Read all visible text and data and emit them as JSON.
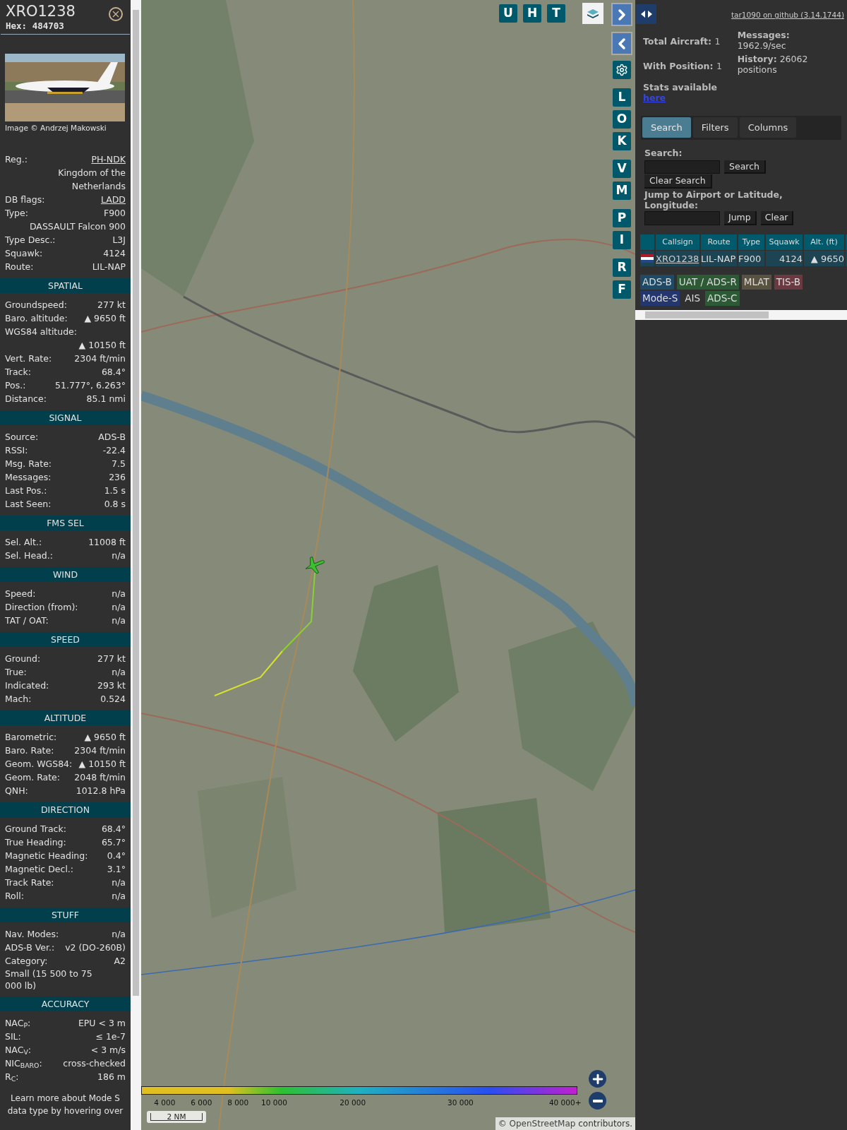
{
  "aircraft": {
    "callsign": "XRO1238",
    "hex": "Hex: 484703",
    "credit": "Image © Andrzej Makowski"
  },
  "sections": [
    {
      "rows": [
        {
          "kind": "pair",
          "label": "Reg.:",
          "value": "PH-NDK",
          "link": true
        },
        {
          "kind": "value",
          "value": "Kingdom of the Netherlands"
        },
        {
          "kind": "pair",
          "label": "DB flags:",
          "value": "LADD",
          "link": true
        },
        {
          "kind": "pair",
          "label": "Type:",
          "value": "F900"
        },
        {
          "kind": "value",
          "value": "DASSAULT Falcon 900"
        },
        {
          "kind": "pair",
          "label": "Type Desc.:",
          "value": "L3J"
        },
        {
          "kind": "pair",
          "label": "Squawk:",
          "value": "4124"
        },
        {
          "kind": "pair",
          "label": "Route:",
          "value": "LIL-NAP"
        }
      ]
    },
    {
      "title": "SPATIAL",
      "rows": [
        {
          "kind": "pair",
          "label": "Groundspeed:",
          "value": "277 kt"
        },
        {
          "kind": "pair",
          "label": "Baro. altitude:",
          "value": "▲ 9650 ft"
        },
        {
          "kind": "label",
          "label": "WGS84 altitude:"
        },
        {
          "kind": "value",
          "value": "▲ 10150 ft"
        },
        {
          "kind": "pair",
          "label": "Vert. Rate:",
          "value": "2304 ft/min"
        },
        {
          "kind": "pair",
          "label": "Track:",
          "value": "68.4°"
        },
        {
          "kind": "pair",
          "label": "Pos.:",
          "value": "51.777°, 6.263°"
        },
        {
          "kind": "pair",
          "label": "Distance:",
          "value": "85.1 nmi"
        }
      ]
    },
    {
      "title": "SIGNAL",
      "rows": [
        {
          "kind": "pair",
          "label": "Source:",
          "value": "ADS-B"
        },
        {
          "kind": "pair",
          "label": "RSSI:",
          "value": "-22.4"
        },
        {
          "kind": "pair",
          "label": "Msg. Rate:",
          "value": "7.5"
        },
        {
          "kind": "pair",
          "label": "Messages:",
          "value": "236"
        },
        {
          "kind": "pair",
          "label": "Last Pos.:",
          "value": "1.5 s"
        },
        {
          "kind": "pair",
          "label": "Last Seen:",
          "value": "0.8 s"
        }
      ]
    },
    {
      "title": "FMS SEL",
      "rows": [
        {
          "kind": "pair",
          "label": "Sel. Alt.:",
          "value": "11008 ft"
        },
        {
          "kind": "pair",
          "label": "Sel. Head.:",
          "value": "n/a"
        }
      ]
    },
    {
      "title": "WIND",
      "rows": [
        {
          "kind": "pair",
          "label": "Speed:",
          "value": "n/a"
        },
        {
          "kind": "pair",
          "label": "Direction (from):",
          "value": "n/a"
        },
        {
          "kind": "pair",
          "label": "TAT / OAT:",
          "value": "n/a"
        }
      ]
    },
    {
      "title": "SPEED",
      "rows": [
        {
          "kind": "pair",
          "label": "Ground:",
          "value": "277 kt"
        },
        {
          "kind": "pair",
          "label": "True:",
          "value": "n/a"
        },
        {
          "kind": "pair",
          "label": "Indicated:",
          "value": "293 kt"
        },
        {
          "kind": "pair",
          "label": "Mach:",
          "value": "0.524"
        }
      ]
    },
    {
      "title": "ALTITUDE",
      "rows": [
        {
          "kind": "pair",
          "label": "Barometric:",
          "value": "▲ 9650 ft"
        },
        {
          "kind": "pair",
          "label": "Baro. Rate:",
          "value": "2304 ft/min"
        },
        {
          "kind": "pair",
          "label": "Geom. WGS84:",
          "value": "▲ 10150 ft"
        },
        {
          "kind": "pair",
          "label": "Geom. Rate:",
          "value": "2048 ft/min"
        },
        {
          "kind": "pair",
          "label": "QNH:",
          "value": "1012.8 hPa"
        }
      ]
    },
    {
      "title": "DIRECTION",
      "rows": [
        {
          "kind": "pair",
          "label": "Ground Track:",
          "value": "68.4°"
        },
        {
          "kind": "pair",
          "label": "True Heading:",
          "value": "65.7°"
        },
        {
          "kind": "pair",
          "label": "Magnetic Heading:",
          "value": "0.4°"
        },
        {
          "kind": "pair",
          "label": "Magnetic Decl.:",
          "value": "3.1°"
        },
        {
          "kind": "pair",
          "label": "Track Rate:",
          "value": "n/a"
        },
        {
          "kind": "pair",
          "label": "Roll:",
          "value": "n/a"
        }
      ]
    },
    {
      "title": "STUFF",
      "rows": [
        {
          "kind": "pair",
          "label": "Nav. Modes:",
          "value": "n/a"
        },
        {
          "kind": "pair",
          "label": "ADS-B Ver.:",
          "value": "v2 (DO-260B)"
        },
        {
          "kind": "pair",
          "label": "Category:",
          "value": "A2"
        },
        {
          "kind": "text",
          "label": "Small (15 500 to 75 000 lb)"
        }
      ]
    },
    {
      "title": "ACCURACY",
      "rows": [
        {
          "kind": "pair",
          "label": "NAC$_{P}$:",
          "value": "EPU < 3 m"
        },
        {
          "kind": "pair",
          "label": "SIL:",
          "value": "≤ 1e-7"
        },
        {
          "kind": "pair",
          "label": "NAC$_{V}$:",
          "value": "< 3 m/s"
        },
        {
          "kind": "pair",
          "label": "NIC$_{BARO}$:",
          "value": "cross-checked"
        },
        {
          "kind": "pair",
          "label": "R$_{C}$:",
          "value": "186 m"
        }
      ]
    }
  ],
  "note": "Learn more about Mode S data type by hovering over",
  "map": {
    "top_buttons": [
      "U",
      "H",
      "T"
    ],
    "side_buttons": [
      [
        "L",
        "O",
        "K"
      ],
      [
        "V",
        "M"
      ],
      [
        "P",
        "I"
      ],
      [
        "R",
        "F"
      ]
    ],
    "legend": [
      "4 000",
      "6 000",
      "8 000",
      "10 000",
      "20 000",
      "30 000",
      "40 000+"
    ],
    "scale": "2 NM",
    "attribution": {
      "prefix": "©",
      "link": "OpenStreetMap",
      "suffix": "contributors."
    }
  },
  "panel": {
    "github": "tar1090 on github (3.14.1744)",
    "stats_left": [
      {
        "label": "Total Aircraft:",
        "value": "1"
      },
      {
        "label": "With Position:",
        "value": "1"
      }
    ],
    "stats_link": {
      "text": "Stats available",
      "link": "here"
    },
    "stats_right": [
      {
        "label": "Messages:",
        "value": "1962.9/sec"
      },
      {
        "label": "History:",
        "value": "26062 positions"
      }
    ],
    "tabs": [
      {
        "label": "Search",
        "selected": true
      },
      {
        "label": "Filters",
        "selected": false
      },
      {
        "label": "Columns",
        "selected": false
      }
    ],
    "search": {
      "label": "Search:",
      "button": "Search",
      "clear": "Clear Search"
    },
    "jump": {
      "label": "Jump to Airport or Latitude, Longitude:",
      "button": "Jump",
      "clear": "Clear"
    },
    "table": {
      "columns": [
        "Callsign",
        "Route",
        "Type",
        "Squawk",
        "Alt. (ft)"
      ],
      "rows": [
        [
          "XRO1238",
          "LIL-NAP",
          "F900",
          "4124",
          "▲ 9650"
        ]
      ]
    },
    "sources": [
      {
        "label": "ADS-B",
        "color": "#1f4a66"
      },
      {
        "label": "UAT / ADS-R",
        "color": "#2c5a34"
      },
      {
        "label": "MLAT",
        "color": "#5a5240"
      },
      {
        "label": "TIS-B",
        "color": "#6b3a40"
      },
      {
        "label": "Mode-S",
        "color": "#23366e"
      },
      {
        "label": "AIS",
        "color": "#303030"
      },
      {
        "label": "ADS-C",
        "color": "#2c5a34"
      }
    ]
  }
}
